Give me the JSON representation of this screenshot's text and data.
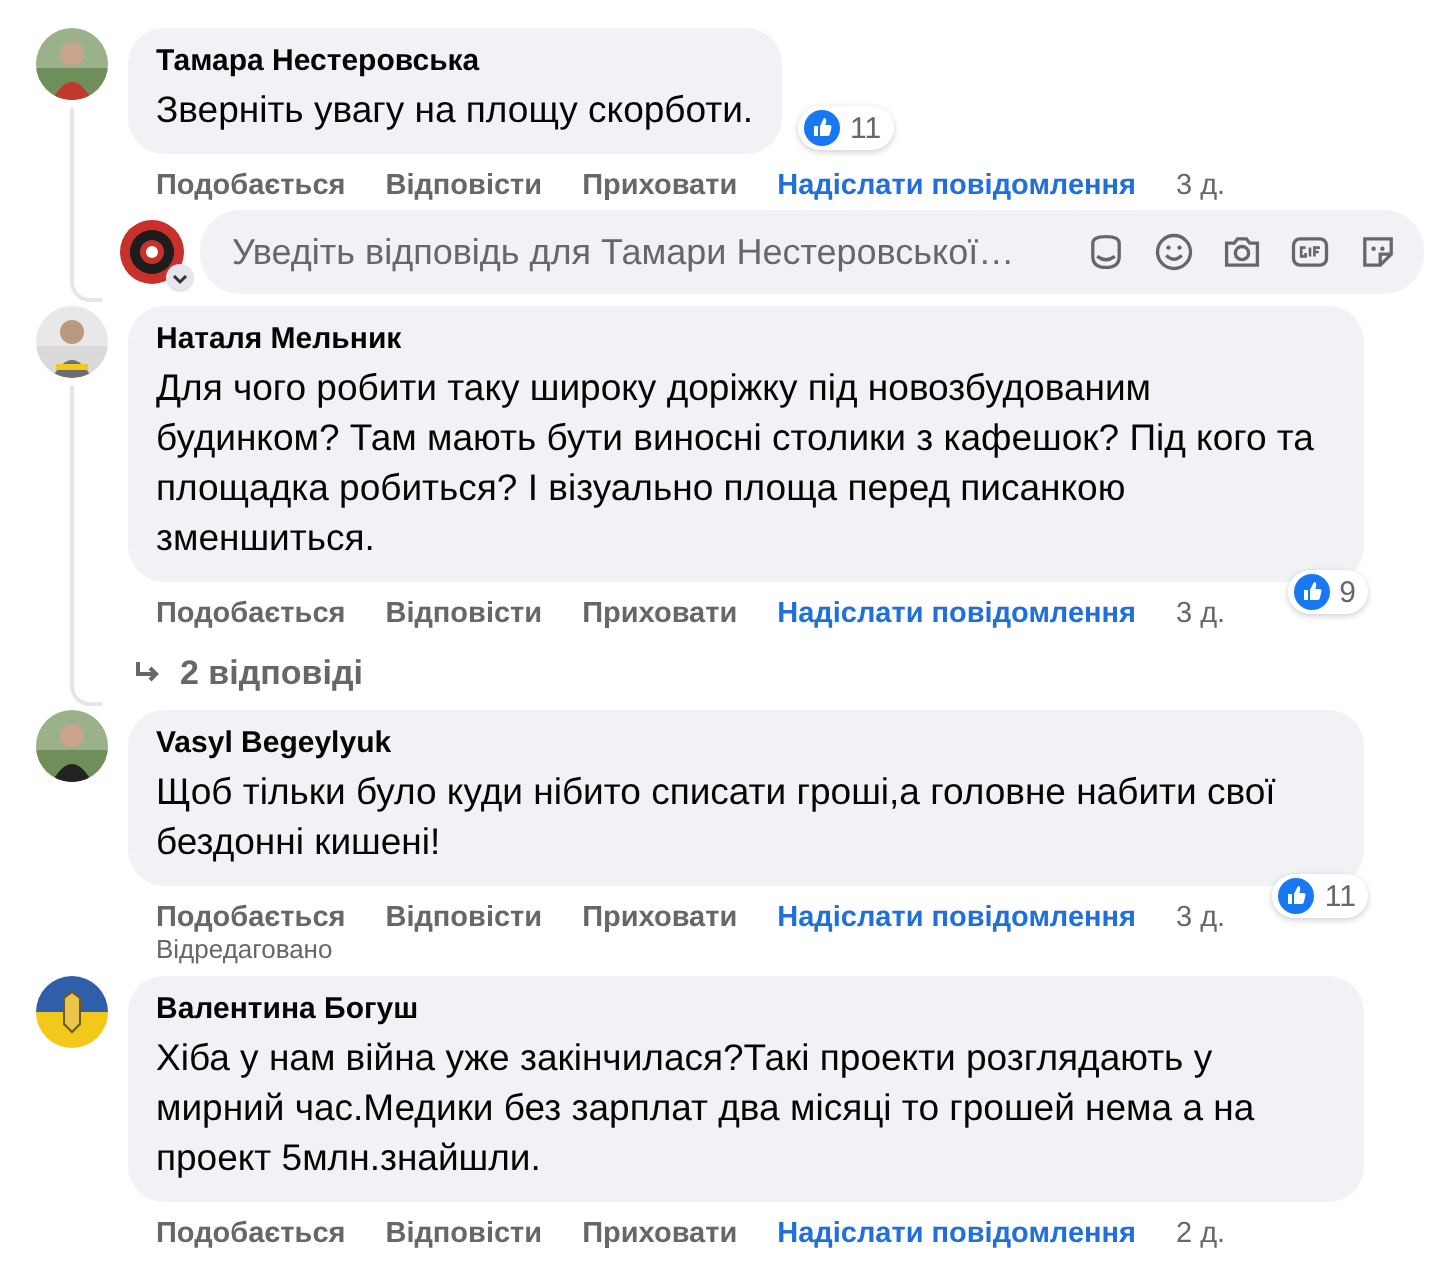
{
  "comments": [
    {
      "author": "Тамара Нестеровська",
      "text": "Зверніть увагу на площу скорботи.",
      "likes": "11",
      "actions": [
        "Подобається",
        "Відповісти",
        "Приховати"
      ],
      "message_link": "Надіслати повідомлення",
      "time": "3 д.",
      "reply_field": {
        "placeholder": "Уведіть відповідь для Тамари Нестеровської…"
      }
    },
    {
      "author": "Наталя Мельник",
      "text": "Для чого робити таку широку доріжку під новозбудованим будинком? Там мають бути виносні столики з кафешок? Під кого та площадка робиться? І візуально площа перед писанкою зменшиться.",
      "likes": "9",
      "actions": [
        "Подобається",
        "Відповісти",
        "Приховати"
      ],
      "message_link": "Надіслати повідомлення",
      "time": "3 д.",
      "replies": "2 відповіді"
    },
    {
      "author": "Vasyl Begeylyuk",
      "text": "Щоб тільки було куди нібито списати гроші,а головне набити свої бездонні кишені!",
      "likes": "11",
      "actions": [
        "Подобається",
        "Відповісти",
        "Приховати"
      ],
      "message_link": "Надіслати повідомлення",
      "time": "3 д.",
      "edited": "Відредаговано"
    },
    {
      "author": "Валентина Богуш",
      "text": "Хіба у нам війна уже закінчилася?Такі проекти розглядають у мирний час.Медики без зарплат два місяці то грошей нема а на проект 5млн.знайшли.",
      "actions": [
        "Подобається",
        "Відповісти",
        "Приховати"
      ],
      "message_link": "Надіслати повідомлення",
      "time": "2 д."
    }
  ]
}
